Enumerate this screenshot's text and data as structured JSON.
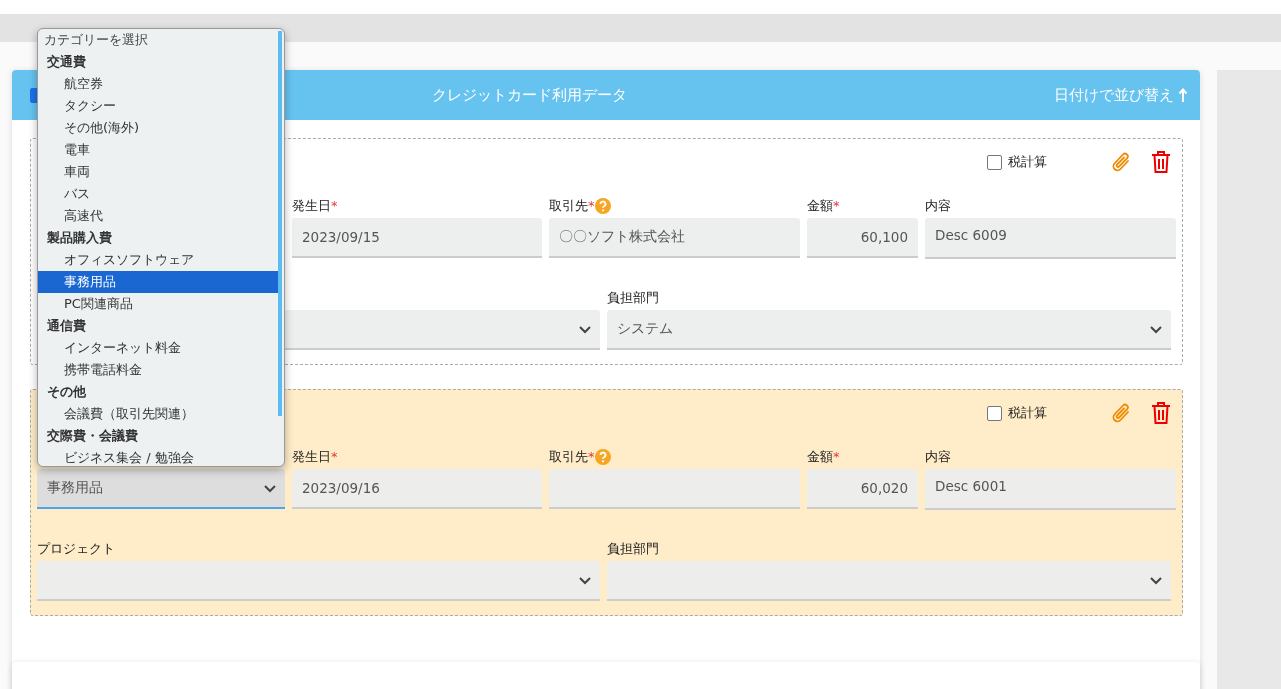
{
  "header": {
    "select_all_checked": true,
    "title": "クレジットカード利用データ",
    "sort_label": "日付けで並び替え"
  },
  "entries": [
    {
      "highlighted": false,
      "tax": {
        "label": "税計算",
        "checked": false
      },
      "fields": [
        {
          "kind": "hidden"
        },
        {
          "kind": "text",
          "label": "発生日",
          "required_mark": "*",
          "value": "2023/09/15"
        },
        {
          "kind": "text",
          "label": "取引先",
          "required_mark": "*",
          "help": true,
          "value": "〇〇ソフト株式会社"
        },
        {
          "kind": "number",
          "label": "金額",
          "required_mark": "*",
          "value": "60,100"
        },
        {
          "kind": "textarea",
          "label": "内容",
          "value": "Desc 6009"
        }
      ],
      "selects": [
        {
          "kind": "select"
        },
        {
          "kind": "select",
          "label": "負担部門",
          "value": "システム"
        }
      ]
    },
    {
      "highlighted": true,
      "tax": {
        "label": "税計算",
        "checked": false
      },
      "fields": [
        {
          "kind": "select",
          "focused": true,
          "value": "事務用品"
        },
        {
          "kind": "text",
          "label": "発生日",
          "required_mark": "*",
          "value": "2023/09/16"
        },
        {
          "kind": "text",
          "label": "取引先",
          "required_mark": "*",
          "help": true
        },
        {
          "kind": "number",
          "label": "金額",
          "required_mark": "*",
          "value": "60,020"
        },
        {
          "kind": "textarea",
          "label": "内容",
          "value": "Desc 6001"
        }
      ],
      "selects": [
        {
          "kind": "select",
          "label": "プロジェクト"
        },
        {
          "kind": "select",
          "label": "負担部門"
        }
      ]
    }
  ],
  "dropdown": {
    "placeholder": "カテゴリーを選択",
    "groups": [
      {
        "label": "交通費",
        "options": [
          {
            "label": "航空券",
            "selected": false
          },
          {
            "label": "タクシー",
            "selected": false
          },
          {
            "label": "その他(海外)",
            "selected": false
          },
          {
            "label": "電車",
            "selected": false
          },
          {
            "label": "車両",
            "selected": false
          },
          {
            "label": "バス",
            "selected": false
          },
          {
            "label": "高速代",
            "selected": false
          }
        ]
      },
      {
        "label": "製品購入費",
        "options": [
          {
            "label": "オフィスソフトウェア",
            "selected": false
          },
          {
            "label": "事務用品",
            "selected": true
          },
          {
            "label": "PC関連商品",
            "selected": false
          }
        ]
      },
      {
        "label": "通信費",
        "options": [
          {
            "label": "インターネット料金",
            "selected": false
          },
          {
            "label": "携帯電話料金",
            "selected": false
          }
        ]
      },
      {
        "label": "その他",
        "options": [
          {
            "label": "会議費（取引先関連）",
            "selected": false
          }
        ]
      },
      {
        "label": "交際費・会議費",
        "options": [
          {
            "label": "ビジネス集会 / 勉強会",
            "selected": false
          }
        ]
      }
    ]
  }
}
